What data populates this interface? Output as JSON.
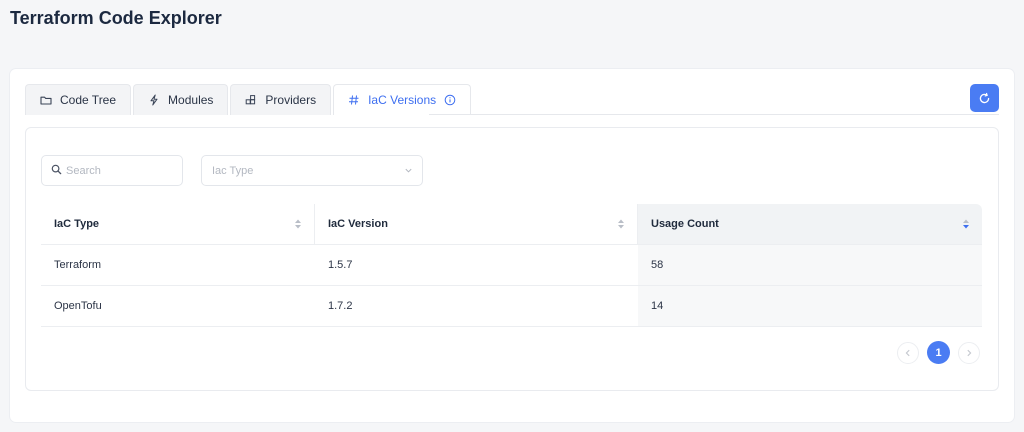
{
  "page": {
    "title": "Terraform Code Explorer"
  },
  "tabs": [
    {
      "label": "Code Tree",
      "icon": "folder-icon"
    },
    {
      "label": "Modules",
      "icon": "lightning-icon"
    },
    {
      "label": "Providers",
      "icon": "blocks-icon"
    },
    {
      "label": "IaC Versions",
      "icon": "hash-icon",
      "active": true,
      "info_icon": "info-icon"
    }
  ],
  "toolbar": {
    "refresh_icon": "refresh-icon"
  },
  "filters": {
    "search_placeholder": "Search",
    "type_placeholder": "Iac Type"
  },
  "table": {
    "columns": [
      "IaC Type",
      "IaC Version",
      "Usage Count"
    ],
    "sorted_column": "Usage Count",
    "rows": [
      {
        "type": "Terraform",
        "version": "1.5.7",
        "count": "58"
      },
      {
        "type": "OpenTofu",
        "version": "1.7.2",
        "count": "14"
      }
    ]
  },
  "pagination": {
    "current_page": "1"
  },
  "colors": {
    "accent": "#4a7cf3",
    "active_tab_text": "#3e6ff0"
  }
}
